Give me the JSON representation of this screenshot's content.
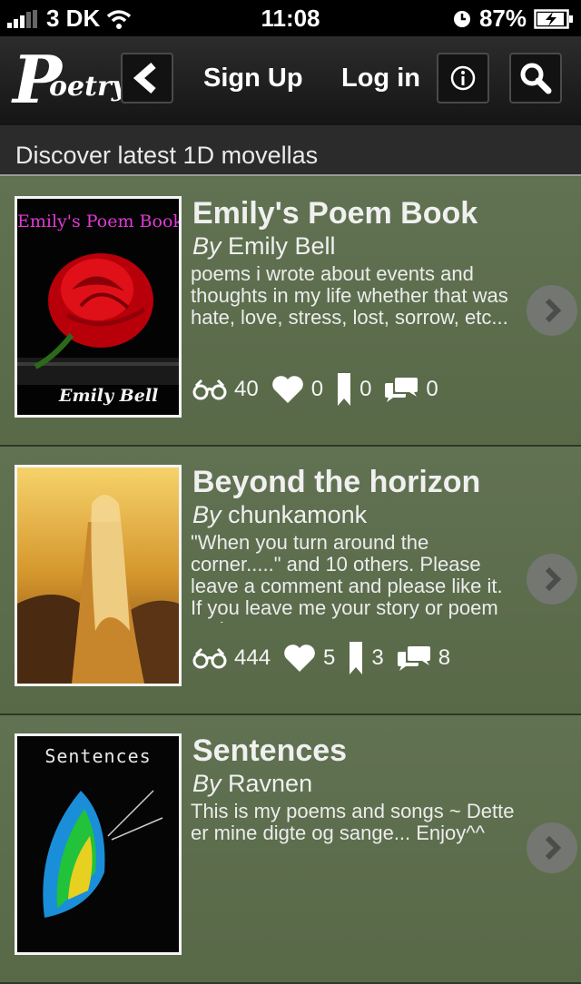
{
  "status": {
    "carrier": "3 DK",
    "time": "11:08",
    "battery": "87%"
  },
  "nav": {
    "logo_big": "P",
    "logo_small": "oetry",
    "sign_up": "Sign Up",
    "log_in": "Log in"
  },
  "section": {
    "title": "Discover latest 1D movellas"
  },
  "items": [
    {
      "title": "Emily's Poem Book",
      "by": "By",
      "author": "Emily Bell",
      "description": "poems i wrote about events and thoughts in my life whether that was hate, love, stress, lost, sorrow, etc...",
      "views": "40",
      "likes": "0",
      "bookmarks": "0",
      "comments": "0",
      "cover_title": "Emily's Poem Book",
      "cover_author": "Emily Bell"
    },
    {
      "title": "Beyond the horizon",
      "by": "By",
      "author": "chunkamonk",
      "description": "\"When you turn around the corner.....\" and 10 others. Please leave a comment and please like it. If you leave me your story or poem and you",
      "views": "444",
      "likes": "5",
      "bookmarks": "3",
      "comments": "8"
    },
    {
      "title": "Sentences",
      "by": "By",
      "author": "Ravnen",
      "description": "This is my poems and songs ~ Dette er mine digte og sange... Enjoy^^",
      "cover_title": "Sentences"
    }
  ]
}
